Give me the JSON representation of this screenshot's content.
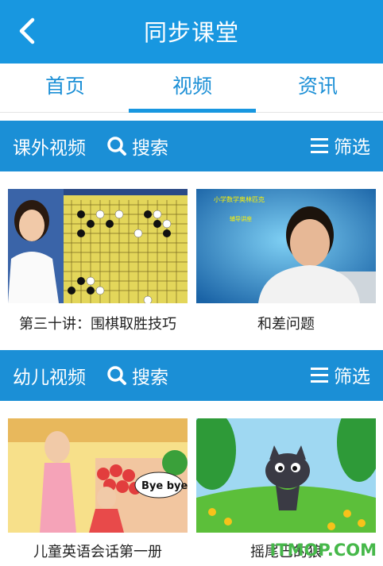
{
  "header": {
    "title": "同步课堂",
    "back_icon": "chevron-left-icon"
  },
  "tabs": [
    {
      "label": "首页",
      "active": false
    },
    {
      "label": "视频",
      "active": true
    },
    {
      "label": "资讯",
      "active": false
    }
  ],
  "sections": [
    {
      "title": "课外视频",
      "search_label": "搜索",
      "filter_label": "筛选",
      "videos": [
        {
          "caption": "第三十讲：围棋取胜技巧"
        },
        {
          "caption": "和差问题",
          "thumb_text_1": "小学数学奥林匹克",
          "thumb_text_2": "辅导讲座"
        }
      ]
    },
    {
      "title": "幼儿视频",
      "search_label": "搜索",
      "filter_label": "筛选",
      "videos": [
        {
          "caption": "儿童英语会话第一册",
          "thumb_text_1": "Bye bye!"
        },
        {
          "caption": "摇尾巴的狼"
        }
      ]
    }
  ],
  "watermark": "ITMOP.COM",
  "colors": {
    "primary": "#1897e0",
    "section_bar": "#1b8fd6",
    "tab_text": "#1b8fd6"
  }
}
